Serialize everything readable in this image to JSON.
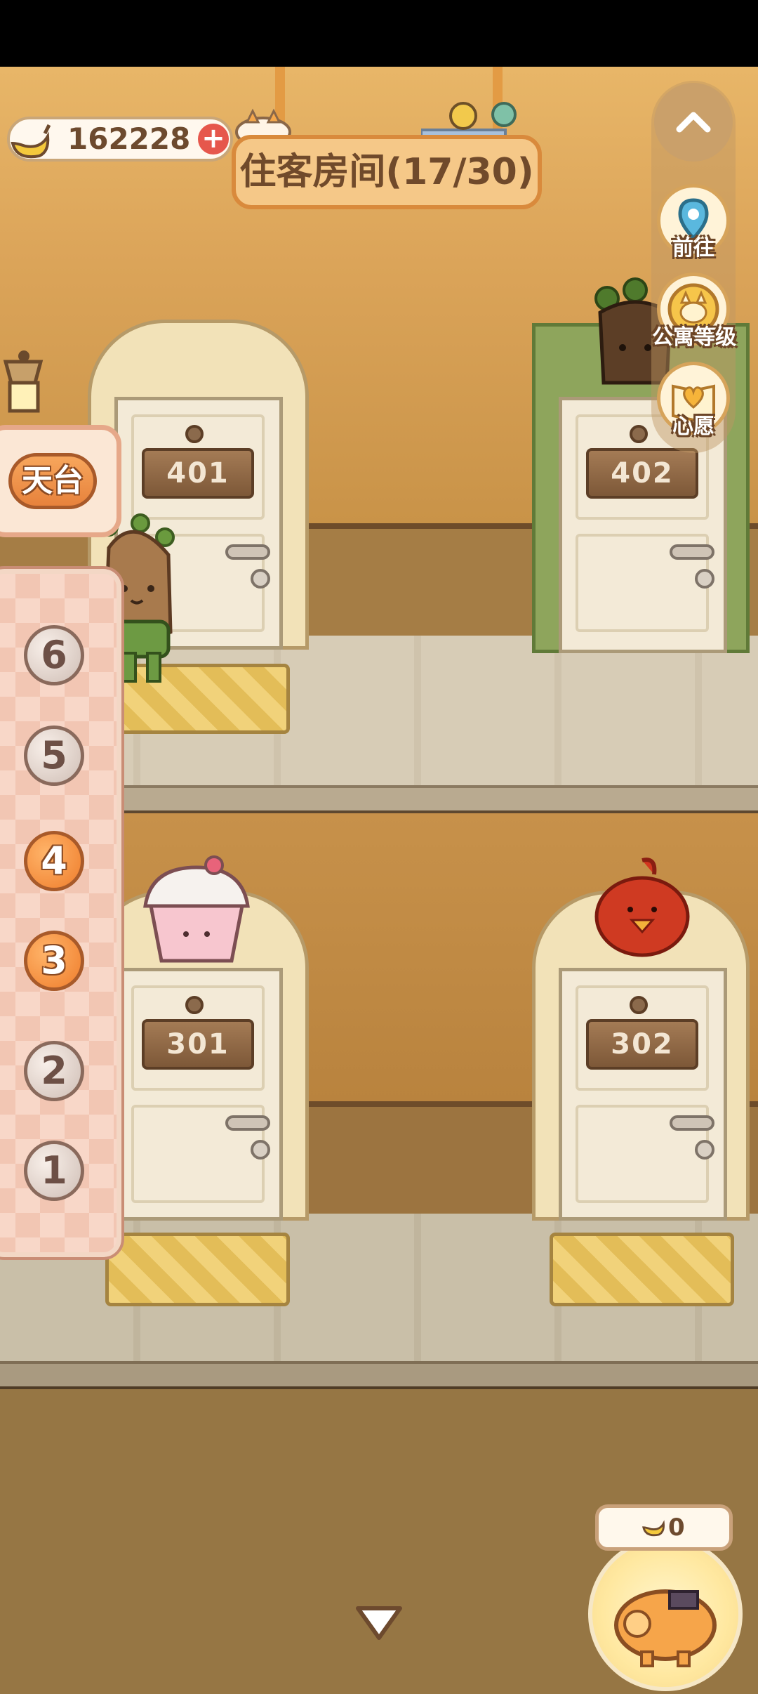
{
  "top_bar": {
    "currency_value": "162228",
    "plus_symbol": "+",
    "title": "住客房间(17/30)"
  },
  "side_menu": {
    "goto_label": "前往",
    "level_label": "公寓等级",
    "wish_label": "心愿"
  },
  "floor_selector": {
    "rooftop_label": "天台",
    "floors": [
      "6",
      "5",
      "4",
      "3",
      "2",
      "1"
    ],
    "active_floors": [
      "4",
      "3"
    ]
  },
  "rooms": {
    "r401": "401",
    "r402": "402",
    "r301": "301",
    "r302": "302"
  },
  "bottom": {
    "income_value": "0"
  },
  "colors": {
    "accent_orange": "#ef7d2c",
    "wall": "#dca55a",
    "plaque_wood": "#8e6845"
  }
}
